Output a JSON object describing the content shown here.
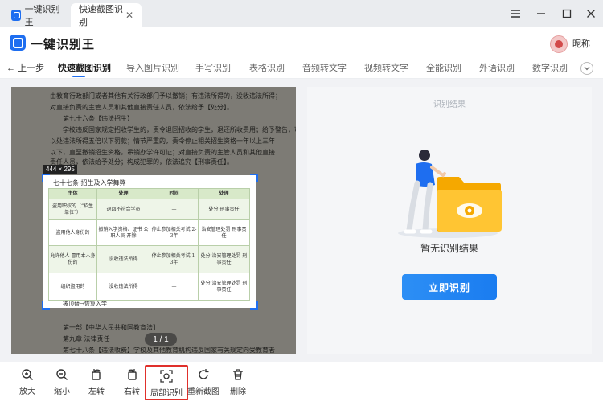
{
  "window": {
    "tab1_label": "一键识别王",
    "tab2_label": "快速截图识别",
    "tab_close": "✕"
  },
  "app": {
    "title": "一键识别王",
    "user_nickname": "昵称"
  },
  "nav": {
    "back_label": "← 上一步",
    "items": [
      {
        "label": "快速截图识别",
        "active": true
      },
      {
        "label": "导入图片识别",
        "active": false
      },
      {
        "label": "手写识别",
        "active": false
      },
      {
        "label": "表格识别",
        "active": false
      },
      {
        "label": "音频转文字",
        "active": false
      },
      {
        "label": "视频转文字",
        "active": false
      },
      {
        "label": "全能识别",
        "active": false
      },
      {
        "label": "外语识别",
        "active": false
      },
      {
        "label": "数字识别",
        "active": false
      }
    ]
  },
  "image": {
    "dimensions_label": "444 × 295",
    "page_indicator": "1 / 1",
    "background_lines": [
      "由教育行政部门或者其他有关行政部门予以撤销；有违法所得的，没收违法所得；",
      "对直接负责的主管人员和其他直接责任人员，依法给予【处分】。",
      "第七十六条【违法招生】",
      "学校违反国家规定招收学生的，责令退回招收的学生，退还所收费用；给予警告，可",
      "以处违法所得五倍以下罚款；情节严重的，责令停止相关招生资格一年以上三年",
      "以下，直至撤销招生资格，吊销办学许可证；对直接负责的主管人员和其他直接",
      "责任人员，依法给予处分；构成犯罪的，依法追究【刑事责任】。"
    ],
    "lower_lines": [
      "第一部【中华人民共和国教育法】",
      "第九章  法律责任",
      "第七十八条【违法收费】学校及其他教育机构违反国家有关规定向受教育者"
    ],
    "table_title": "七十七条    招生及入学舞弊",
    "table_headers": [
      "主体",
      "处理",
      "时间",
      "处理"
    ],
    "table_rows": [
      [
        "盗用职权的（“招生单位”）",
        "退回不符合学员",
        "—",
        "处分 刑事责任"
      ],
      [
        "盗用他人身份的",
        "撤销入学资格、证书 公职人员-开除",
        "停止参加相关考试 2-3年",
        "治安管理处罚 刑事责任"
      ],
      [
        "允许他人 冒用本人身份的",
        "没收违法所得",
        "停止参加相关考试 1-3年",
        "处分 治安管理处罚 刑事责任"
      ],
      [
        "组织盗用的",
        "没收违法所得",
        "—",
        "处分 治安管理处罚 刑事责任"
      ]
    ],
    "table_footer": "被顶替→恢复入学"
  },
  "result": {
    "title": "识别结果",
    "empty_text": "暂无识别结果",
    "start_button": "立即识别"
  },
  "toolbar": {
    "items": [
      {
        "label": "放大",
        "icon": "zoom-in-icon"
      },
      {
        "label": "缩小",
        "icon": "zoom-out-icon"
      },
      {
        "label": "左转",
        "icon": "rotate-left-icon"
      },
      {
        "label": "右转",
        "icon": "rotate-right-icon"
      },
      {
        "label": "局部识别",
        "icon": "partial-recognize-icon",
        "highlighted": true
      },
      {
        "label": "重新截图",
        "icon": "refresh-icon"
      },
      {
        "label": "删除",
        "icon": "trash-icon"
      }
    ]
  },
  "colors": {
    "accent": "#1e6ef0",
    "button": "#1a7cf0",
    "highlight": "#e0302b",
    "folder": "#f7b500"
  }
}
